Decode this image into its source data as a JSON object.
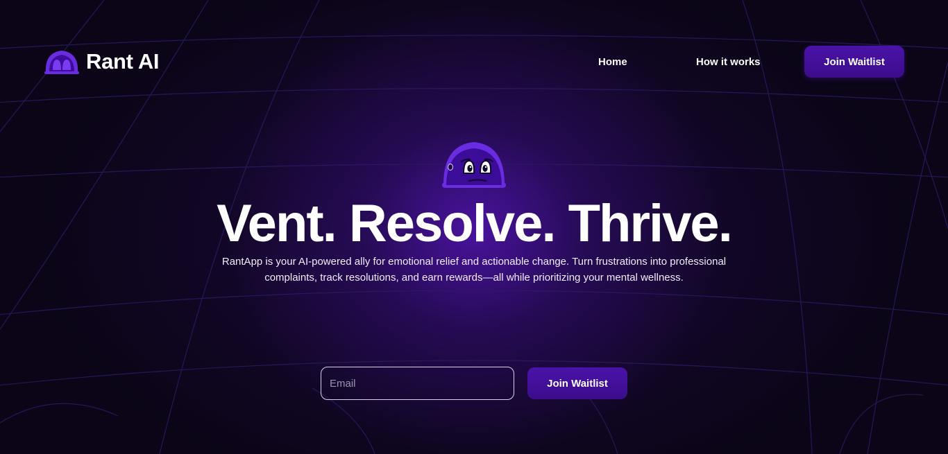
{
  "brand": {
    "name": "Rant AI",
    "logo_icon": "robot-face-icon",
    "accent_color": "#5b1fd6"
  },
  "nav": {
    "home_label": "Home",
    "how_label": "How it works",
    "cta_label": "Join Waitlist"
  },
  "hero": {
    "mascot_icon": "worried-robot-mascot-icon",
    "title": "Vent. Resolve. Thrive.",
    "subtitle_line1": "RantApp is your AI-powered ally for emotional relief and actionable change. Turn frustrations into professional",
    "subtitle_line2": "complaints, track resolutions, and earn rewards—all while prioritizing your mental wellness."
  },
  "waitlist_form": {
    "email_placeholder": "Email",
    "email_value": "",
    "submit_label": "Join Waitlist"
  }
}
